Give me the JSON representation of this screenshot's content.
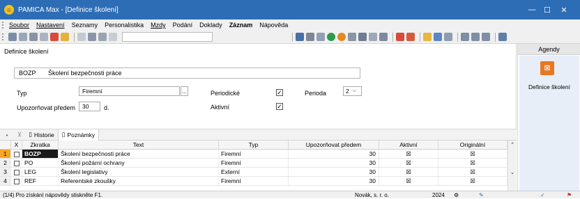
{
  "window": {
    "title": "PAMICA Max - [Definice školení]",
    "minimize": "—",
    "maximize": "☐",
    "close": "✕"
  },
  "menu": [
    {
      "label": "Soubor",
      "ul": true
    },
    {
      "label": "Nastavení",
      "ul": true
    },
    {
      "label": "Seznamy",
      "ul": false
    },
    {
      "label": "Personalistika",
      "ul": false
    },
    {
      "label": "Mzdy",
      "ul": true
    },
    {
      "label": "Podání",
      "ul": false
    },
    {
      "label": "Doklady",
      "ul": false
    },
    {
      "label": "Záznam",
      "ul": false,
      "bold": true
    },
    {
      "label": "Nápověda",
      "ul": false
    }
  ],
  "form": {
    "section_label": "Definice školení",
    "code": "BOZP",
    "name": "Školení bezpečnosti práce",
    "typ_label": "Typ",
    "typ_value": "Firemní",
    "upozornovat_label": "Upozorňovat předem",
    "upozornovat_value": "30",
    "upozornovat_unit": "d.",
    "periodicke_label": "Periodické",
    "aktivni_label": "Aktivní",
    "perioda_label": "Perioda",
    "perioda_value": "2",
    "ellipsis": "...",
    "dropdown_arrow": "⌵"
  },
  "agendy": {
    "header": "Agendy",
    "item_label": "Definice školení",
    "item_icon": "definice-skoleni-icon"
  },
  "tabs": {
    "dot": "•",
    "filter": "⊻",
    "historie": "Historie",
    "poznamky": "Poznámky"
  },
  "grid": {
    "columns": [
      "",
      "X",
      "Zkratka",
      "Text",
      "Typ",
      "Upozorňovat předem",
      "Aktivní",
      "Originální"
    ],
    "rows": [
      {
        "num": "1",
        "zkratka": "BOZP",
        "text": "Školení bezpečnosti práce",
        "typ": "Firemní",
        "upoz": "30",
        "aktivni": "☒",
        "originalni": "☒"
      },
      {
        "num": "2",
        "zkratka": "PO",
        "text": "Školení požární ochrany",
        "typ": "Firemní",
        "upoz": "30",
        "aktivni": "☒",
        "originalni": "☒"
      },
      {
        "num": "3",
        "zkratka": "LEG",
        "text": "Školení legislativy",
        "typ": "Externí",
        "upoz": "30",
        "aktivni": "☒",
        "originalni": "☒"
      },
      {
        "num": "4",
        "zkratka": "REF",
        "text": "Referentské zkoušky",
        "typ": "Firemní",
        "upoz": "30",
        "aktivni": "☒",
        "originalni": "☒"
      }
    ]
  },
  "status": {
    "hint": "(1/4) Pro získání nápovědy stiskněte F1.",
    "company": "Novák, s. r. o.",
    "year": "2024"
  },
  "colors": {
    "title_blue": "#2d6db5",
    "accent_orange": "#e87722"
  }
}
